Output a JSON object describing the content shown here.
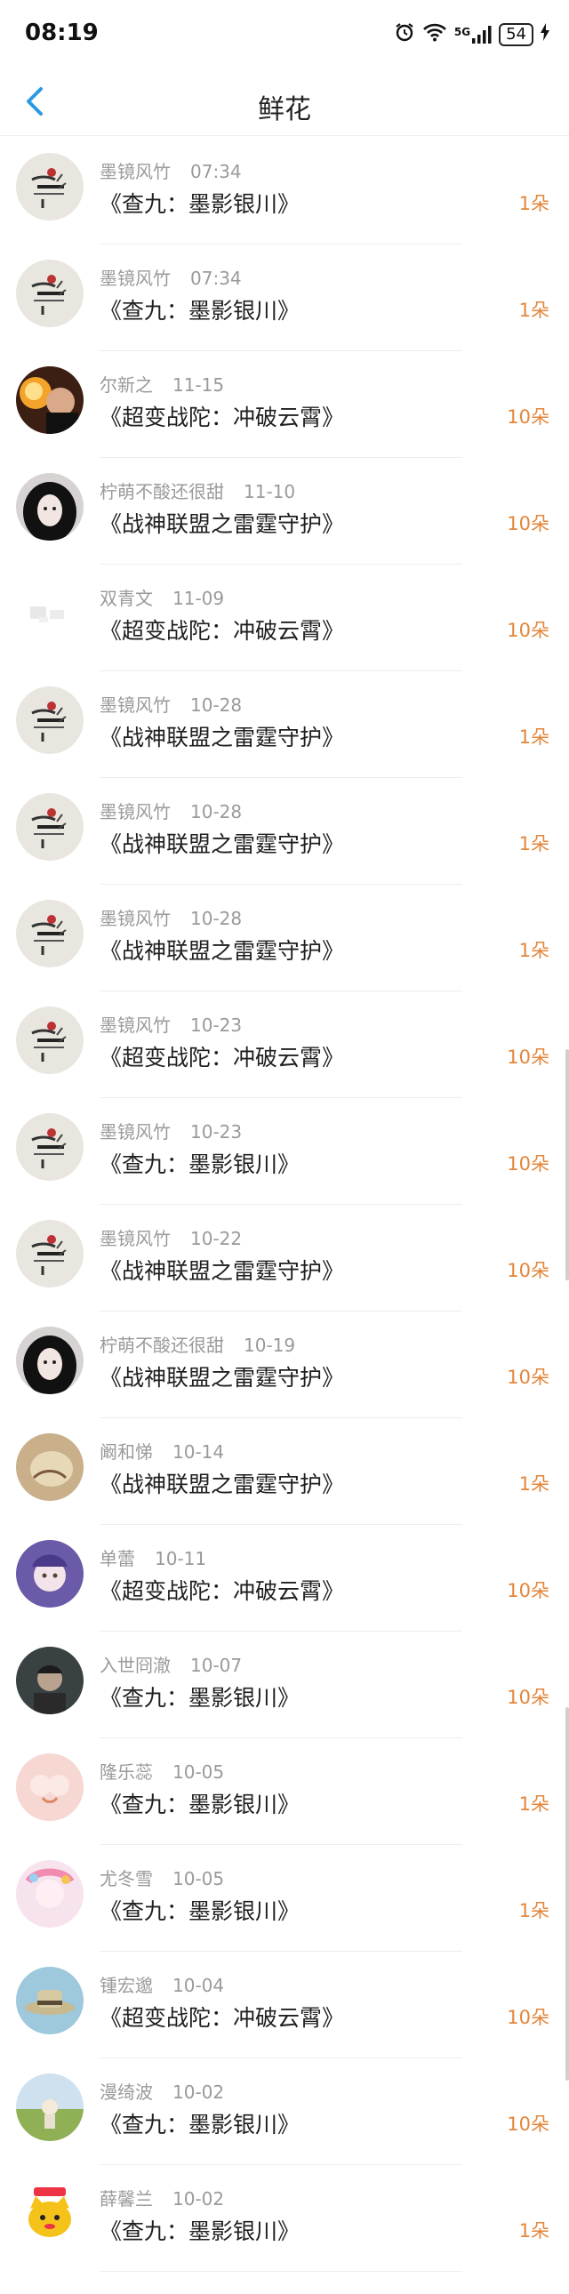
{
  "status_bar": {
    "time": "08:19",
    "icons": [
      "alarm-icon",
      "wifi-icon",
      "signal-5g-icon"
    ],
    "signal_label": "5G",
    "battery": "54"
  },
  "header": {
    "title": "鲜花",
    "back_icon": "chevron-left-icon"
  },
  "colors": {
    "accent": "#2a9be0",
    "count": "#e3863b",
    "meta": "#9a9a9a"
  },
  "rows": [
    {
      "user": "墨镜风竹",
      "time": "07:34",
      "book": "《查九：墨影银川》",
      "count": "1朵",
      "avatar": "ink"
    },
    {
      "user": "墨镜风竹",
      "time": "07:34",
      "book": "《查九：墨影银川》",
      "count": "1朵",
      "avatar": "ink"
    },
    {
      "user": "尔新之",
      "time": "11-15",
      "book": "《超变战陀：冲破云霄》",
      "count": "10朵",
      "avatar": "fire"
    },
    {
      "user": "柠萌不酸还很甜",
      "time": "11-10",
      "book": "《战神联盟之雷霆守护》",
      "count": "10朵",
      "avatar": "girl"
    },
    {
      "user": "双青文",
      "time": "11-09",
      "book": "《超变战陀：冲破云霄》",
      "count": "10朵",
      "avatar": "faint"
    },
    {
      "user": "墨镜风竹",
      "time": "10-28",
      "book": "《战神联盟之雷霆守护》",
      "count": "1朵",
      "avatar": "ink"
    },
    {
      "user": "墨镜风竹",
      "time": "10-28",
      "book": "《战神联盟之雷霆守护》",
      "count": "1朵",
      "avatar": "ink"
    },
    {
      "user": "墨镜风竹",
      "time": "10-28",
      "book": "《战神联盟之雷霆守护》",
      "count": "1朵",
      "avatar": "ink"
    },
    {
      "user": "墨镜风竹",
      "time": "10-23",
      "book": "《超变战陀：冲破云霄》",
      "count": "10朵",
      "avatar": "ink"
    },
    {
      "user": "墨镜风竹",
      "time": "10-23",
      "book": "《查九：墨影银川》",
      "count": "10朵",
      "avatar": "ink"
    },
    {
      "user": "墨镜风竹",
      "time": "10-22",
      "book": "《战神联盟之雷霆守护》",
      "count": "10朵",
      "avatar": "ink"
    },
    {
      "user": "柠萌不酸还很甜",
      "time": "10-19",
      "book": "《战神联盟之雷霆守护》",
      "count": "10朵",
      "avatar": "girl"
    },
    {
      "user": "阚和悌",
      "time": "10-14",
      "book": "《战神联盟之雷霆守护》",
      "count": "1朵",
      "avatar": "tan"
    },
    {
      "user": "单蕾",
      "time": "10-11",
      "book": "《超变战陀：冲破云霄》",
      "count": "10朵",
      "avatar": "purple"
    },
    {
      "user": "入世冏澈",
      "time": "10-07",
      "book": "《查九：墨影银川》",
      "count": "10朵",
      "avatar": "dark"
    },
    {
      "user": "隆乐蕊",
      "time": "10-05",
      "book": "《查九：墨影银川》",
      "count": "1朵",
      "avatar": "pink"
    },
    {
      "user": "尤冬雪",
      "time": "10-05",
      "book": "《查九：墨影银川》",
      "count": "1朵",
      "avatar": "anime"
    },
    {
      "user": "锺宏邈",
      "time": "10-04",
      "book": "《超变战陀：冲破云霄》",
      "count": "10朵",
      "avatar": "hat"
    },
    {
      "user": "漫绮波",
      "time": "10-02",
      "book": "《查九：墨影银川》",
      "count": "10朵",
      "avatar": "field"
    },
    {
      "user": "薛馨兰",
      "time": "10-02",
      "book": "《查九：墨影银川》",
      "count": "1朵",
      "avatar": "cat"
    }
  ]
}
